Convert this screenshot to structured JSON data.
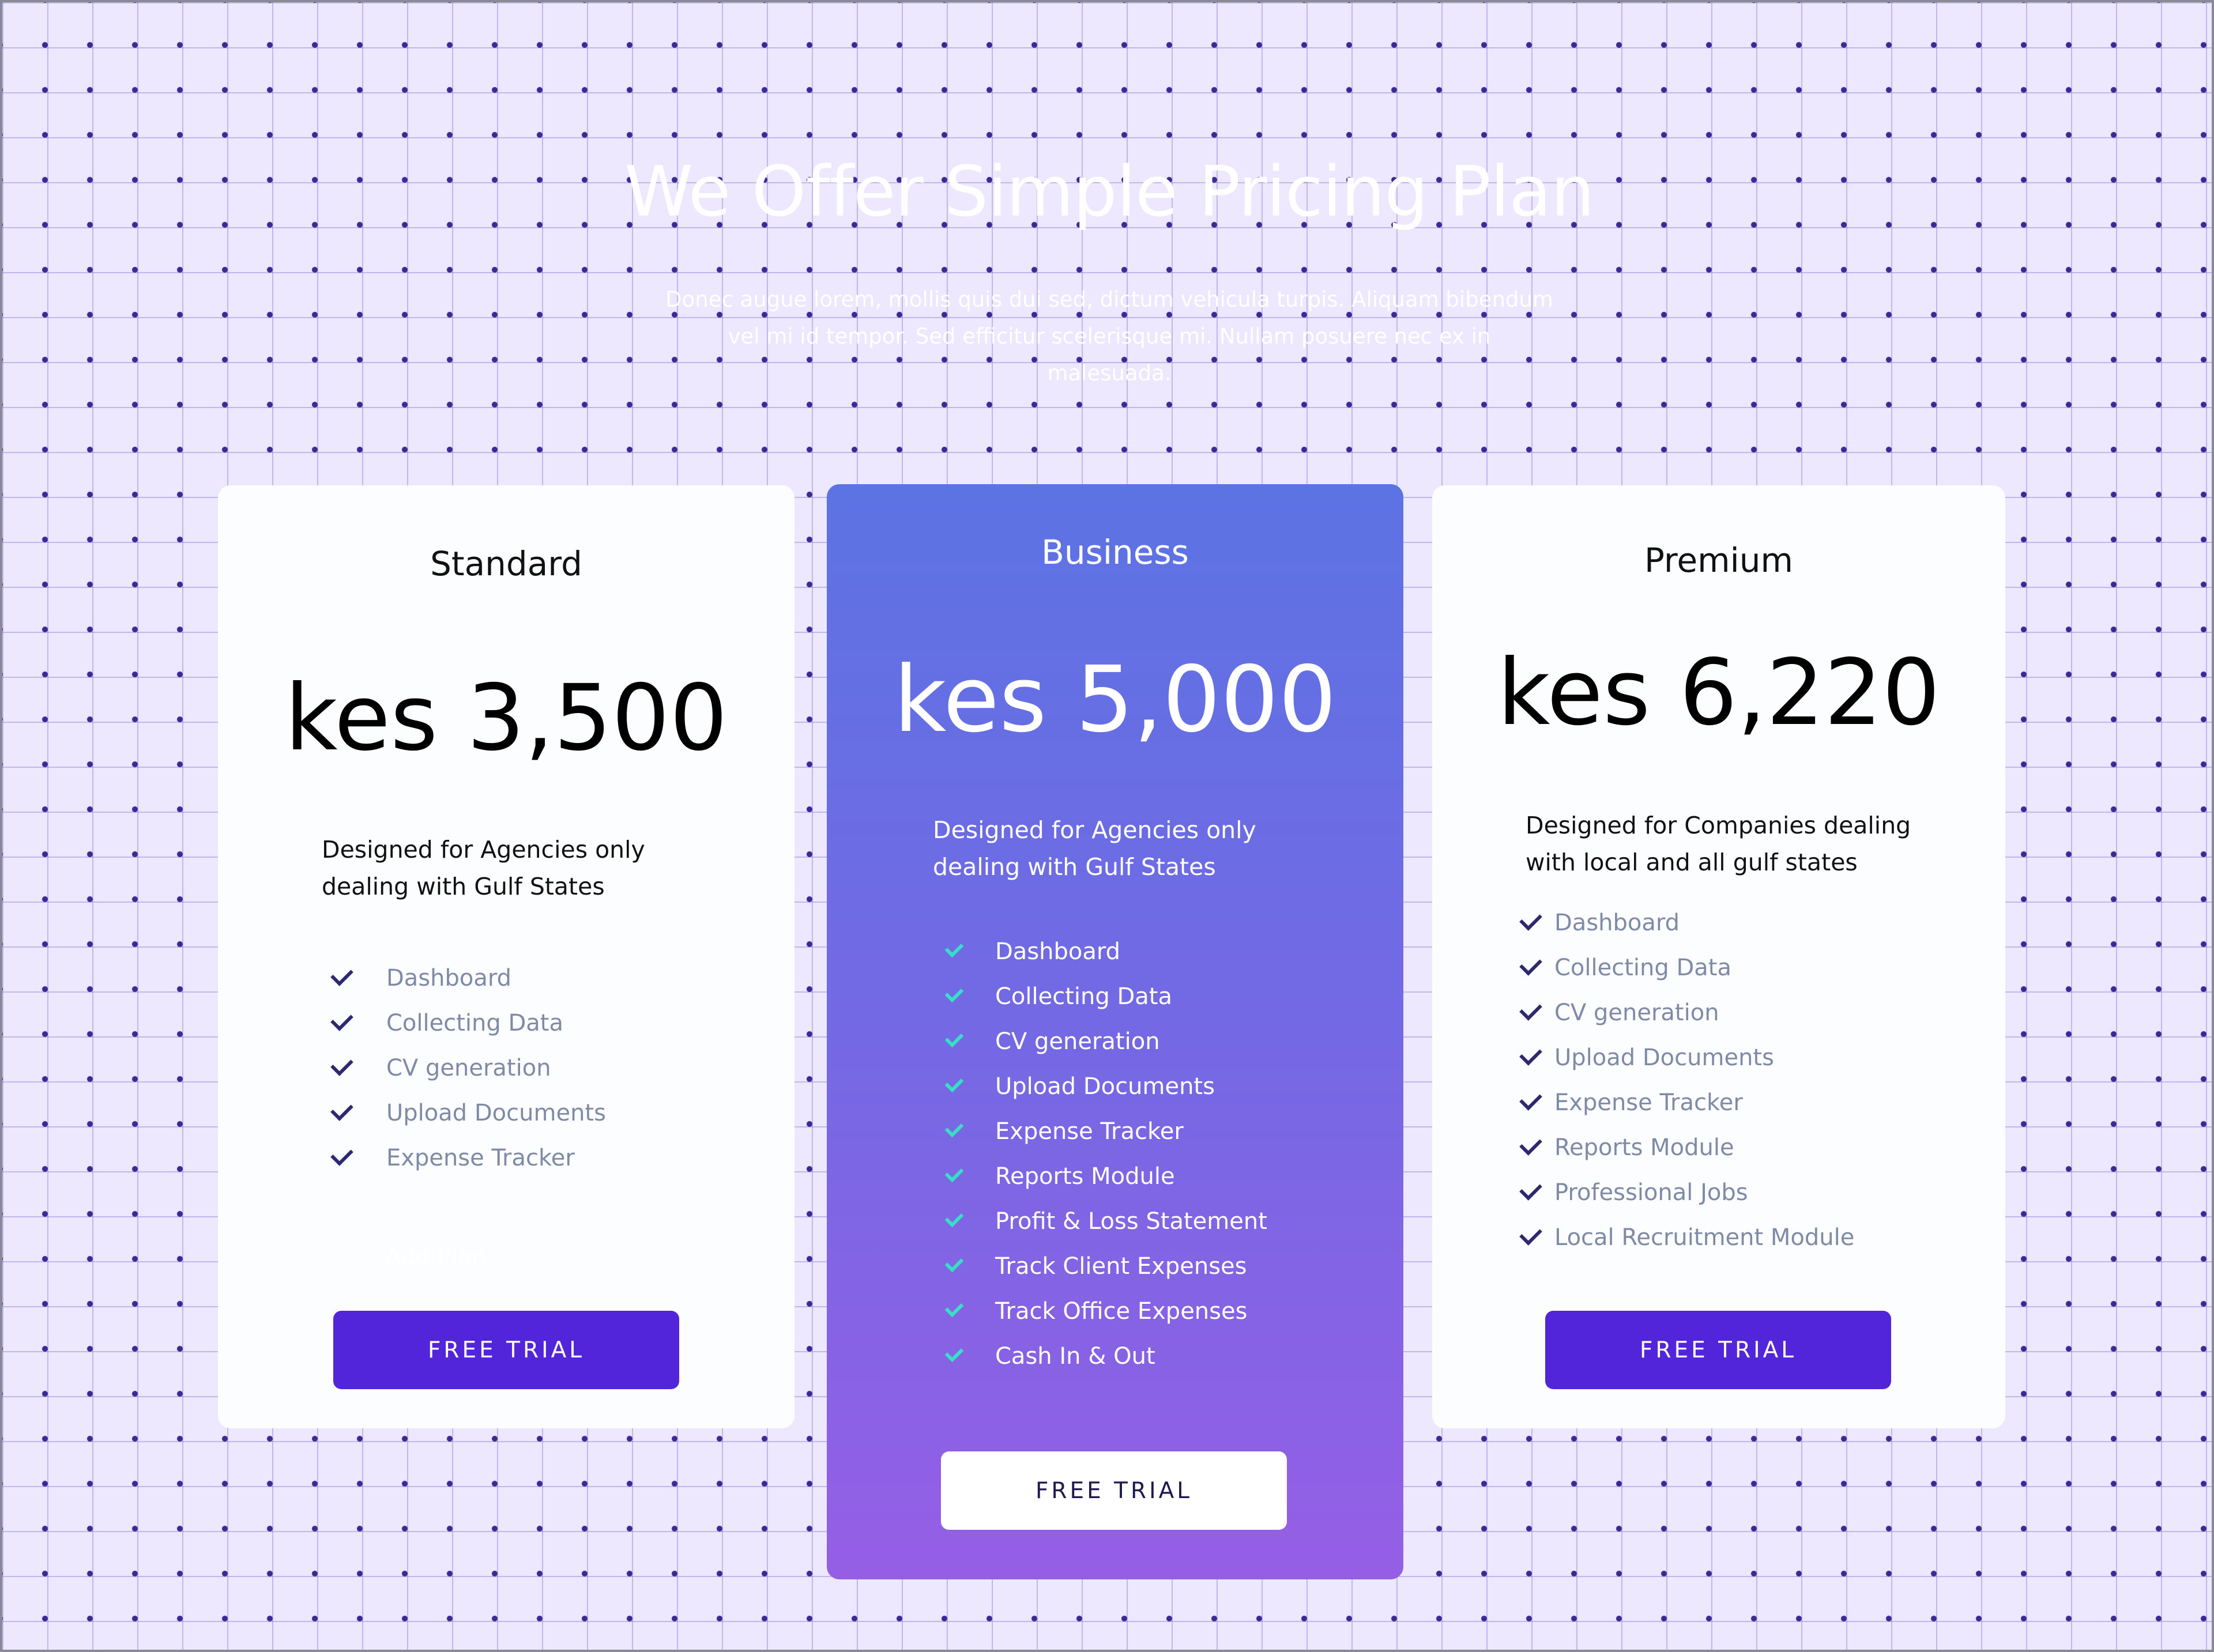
{
  "hero": {
    "title": "We Offer Simple Pricing Plan",
    "subtitle": "Donec augue lorem, mollis quis dui sed, dictum vehicula turpis. Aliquam bibendum vel mi id tempor. Sed efficitur scelerisque mi. Nullam posuere nec ex in malesuada."
  },
  "plans": {
    "standard": {
      "name": "Standard",
      "price": "kes 3,500",
      "description": "Designed for Agencies only dealing with Gulf States",
      "features": [
        "Dashboard",
        "Collecting Data",
        "CV generation",
        "Upload Documents",
        "Expense Tracker"
      ],
      "hidden_note": "Add Plan",
      "button_label": "FREE TRIAL"
    },
    "business": {
      "name": "Business",
      "price": "kes 5,000",
      "description": "Designed for Agencies only dealing with Gulf States",
      "features": [
        "Dashboard",
        "Collecting Data",
        "CV generation",
        "Upload Documents",
        "Expense Tracker",
        "Reports Module",
        "Profit & Loss Statement",
        "Track Client Expenses",
        "Track Office Expenses",
        "Cash In & Out"
      ],
      "button_label": "FREE TRIAL"
    },
    "premium": {
      "name": "Premium",
      "price": "kes 6,220",
      "description": "Designed for Companies dealing with local and all gulf states",
      "features": [
        "Dashboard",
        "Collecting Data",
        "CV generation",
        "Upload Documents",
        "Expense Tracker",
        "Reports Module",
        "Professional Jobs",
        "Local Recruitment Module"
      ],
      "button_label": "FREE TRIAL"
    }
  },
  "icons": {
    "feature_check": "check-icon"
  },
  "colors": {
    "background": "#ede8fd",
    "accent_purple": "#5325da",
    "business_gradient_top": "#5c73e4",
    "business_gradient_bottom": "#955ee5",
    "check_dark": "#2e2870",
    "check_teal": "#35e0c4",
    "feature_text": "#7f8aa6"
  }
}
